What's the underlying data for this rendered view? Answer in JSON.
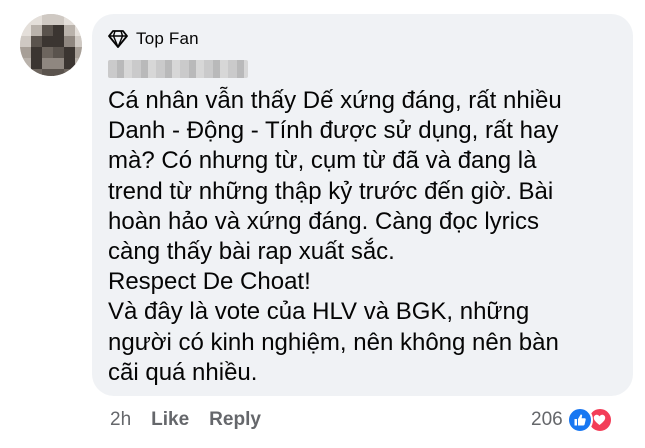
{
  "comment": {
    "badge_label": "Top Fan",
    "badge_icon": "diamond-icon",
    "lines": [
      "Cá nhân vẫn thấy Dế xứng đáng, rất nhiều",
      "Danh - Động - Tính được sử dụng, rất hay",
      "mà? Có nhưng từ, cụm từ đã và đang là",
      "trend từ những thập kỷ trước đến giờ. Bài",
      "hoàn hảo và xứng đáng. Càng đọc lyrics",
      "càng thấy bài rap xuất sắc.",
      "Respect De Choat!",
      "Và đây là vote của HLV và BGK, những",
      "người có kinh nghiệm, nên không nên bàn",
      "cãi quá nhiều."
    ]
  },
  "actions": {
    "time": "2h",
    "like_label": "Like",
    "reply_label": "Reply"
  },
  "reactions": {
    "count": "206",
    "icons": [
      "like-icon",
      "love-icon"
    ]
  },
  "colors": {
    "bubble": "#f0f2f5",
    "text": "#050505",
    "secondary": "#65676b",
    "like_blue": "#1877f2",
    "love_red": "#f33e58"
  }
}
